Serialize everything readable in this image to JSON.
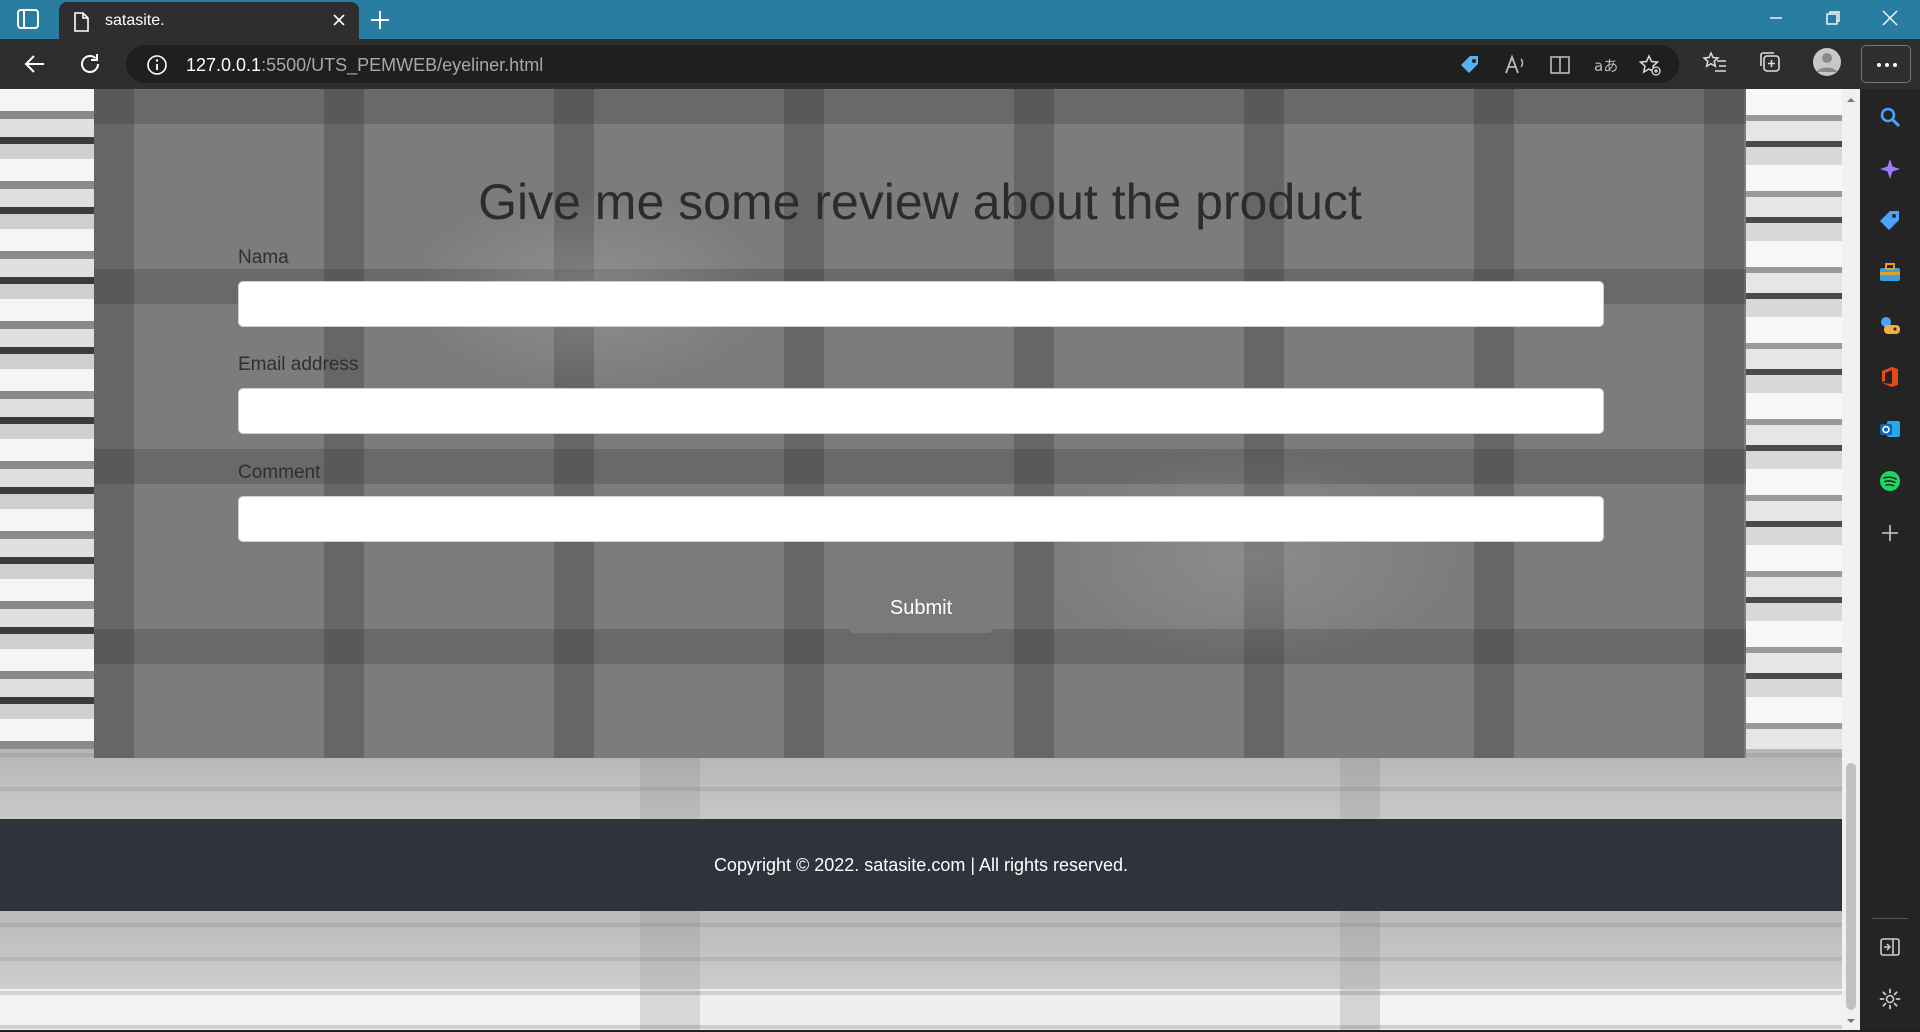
{
  "browser": {
    "tab_title": "satasite.",
    "url_host": "127.0.0.1",
    "url_path": ":5500/UTS_PEMWEB/eyeliner.html",
    "accent": "#287da0"
  },
  "page": {
    "review": {
      "title": "Give me some review about the product",
      "fields": [
        {
          "label": "Nama",
          "value": "",
          "placeholder": ""
        },
        {
          "label": "Email address",
          "value": "",
          "placeholder": ""
        },
        {
          "label": "Comment",
          "value": "",
          "placeholder": ""
        }
      ],
      "submit_label": "Submit"
    },
    "footer": {
      "text": "Copyright © 2022. satasite.com | All rights reserved."
    }
  },
  "icons": {
    "tabbar": [
      "sidebar-toggle-icon",
      "page-icon",
      "close-icon",
      "plus-icon",
      "minimize-icon",
      "restore-icon",
      "close-window-icon"
    ],
    "toolbar": [
      "back-icon",
      "refresh-icon",
      "info-icon",
      "coupon-icon",
      "read-aloud-icon",
      "immersive-reader-icon",
      "translate-icon",
      "add-favorite-icon",
      "favorites-icon",
      "collections-icon",
      "profile-icon",
      "more-icon"
    ],
    "sidepanel": [
      "search-icon",
      "copilot-icon",
      "shopping-icon",
      "tools-icon",
      "games-icon",
      "office-icon",
      "outlook-icon",
      "spotify-icon",
      "add-icon",
      "panel-toggle-icon",
      "settings-icon"
    ]
  }
}
